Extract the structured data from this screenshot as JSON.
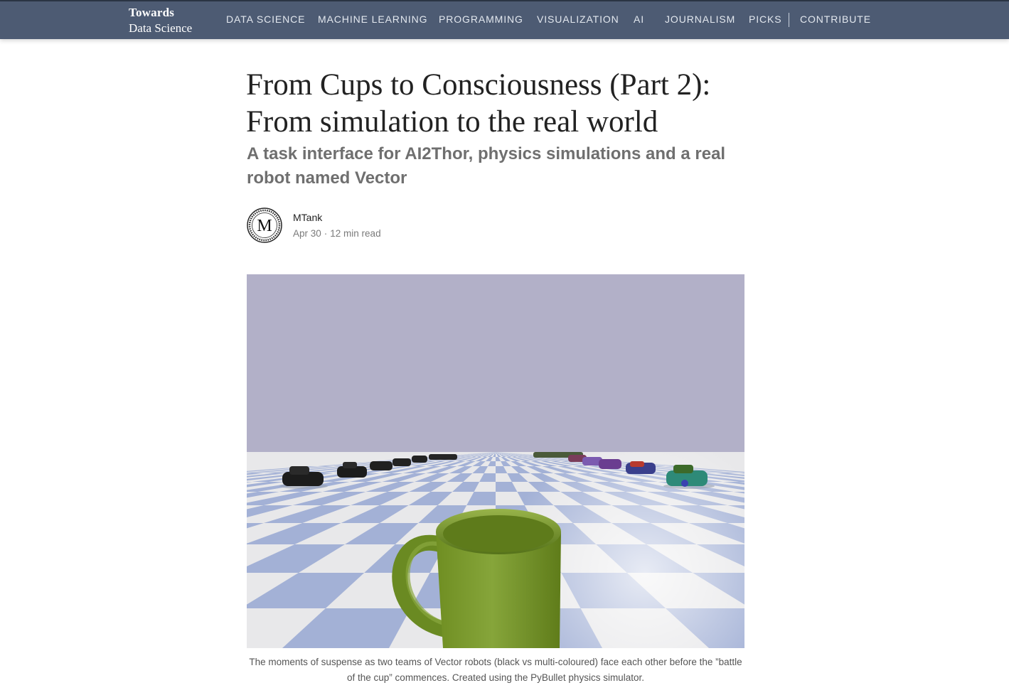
{
  "brand": {
    "line1": "Towards",
    "line2": "Data Science"
  },
  "nav": {
    "items": [
      "DATA SCIENCE",
      "MACHINE LEARNING",
      "PROGRAMMING",
      "VISUALIZATION",
      "AI",
      "JOURNALISM",
      "PICKS"
    ],
    "contribute": "CONTRIBUTE"
  },
  "article": {
    "title": "From Cups to Consciousness (Part 2): From simulation to the real world",
    "subtitle": "A task interface for AI2Thor, physics simulations and a real robot named Vector",
    "author": {
      "name": "MTank",
      "avatar_letter": "M",
      "date": "Apr 30",
      "separator": "·",
      "read_time": "12 min read"
    },
    "hero_image": {
      "caption": "The moments of suspense as two teams of Vector robots (black vs multi-coloured) face each other before the ”battle of the cup” commences. Created using the PyBullet physics simulator."
    }
  },
  "colors": {
    "nav_background": "#4d5b73",
    "sky": "#b2b0c8",
    "floor_tile_blue": "#a3b1d6",
    "floor_tile_white": "#e8e8ea",
    "cup_green": "#7a9a2c"
  }
}
